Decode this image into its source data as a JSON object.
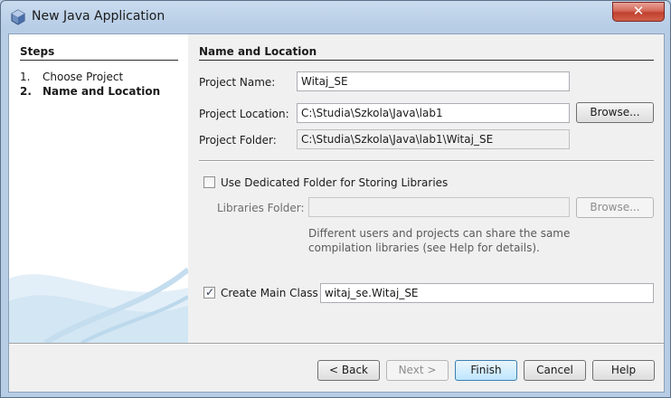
{
  "window": {
    "title": "New Java Application",
    "close_label": "✕"
  },
  "steps": {
    "title": "Steps",
    "items": [
      {
        "num": "1.",
        "label": "Choose Project"
      },
      {
        "num": "2.",
        "label": "Name and Location"
      }
    ]
  },
  "section": {
    "title": "Name and Location"
  },
  "form": {
    "project_name_label": "Project Name:",
    "project_name_value": "Witaj_SE",
    "project_location_label": "Project Location:",
    "project_location_value": "C:\\Studia\\Szkola\\Java\\lab1",
    "browse_label": "Browse...",
    "project_folder_label": "Project Folder:",
    "project_folder_value": "C:\\Studia\\Szkola\\Java\\lab1\\Witaj_SE",
    "dedicated_folder_label": "Use Dedicated Folder for Storing Libraries",
    "dedicated_folder_checked": false,
    "libraries_folder_label": "Libraries Folder:",
    "libraries_folder_value": "",
    "libraries_browse_label": "Browse...",
    "help_text": "Different users and projects can share the same compilation libraries (see Help for details).",
    "create_main_class_label": "Create Main Class",
    "create_main_class_checked": true,
    "main_class_value": "witaj_se.Witaj_SE"
  },
  "buttons": {
    "back": "< Back",
    "next": "Next >",
    "finish": "Finish",
    "cancel": "Cancel",
    "help": "Help"
  }
}
